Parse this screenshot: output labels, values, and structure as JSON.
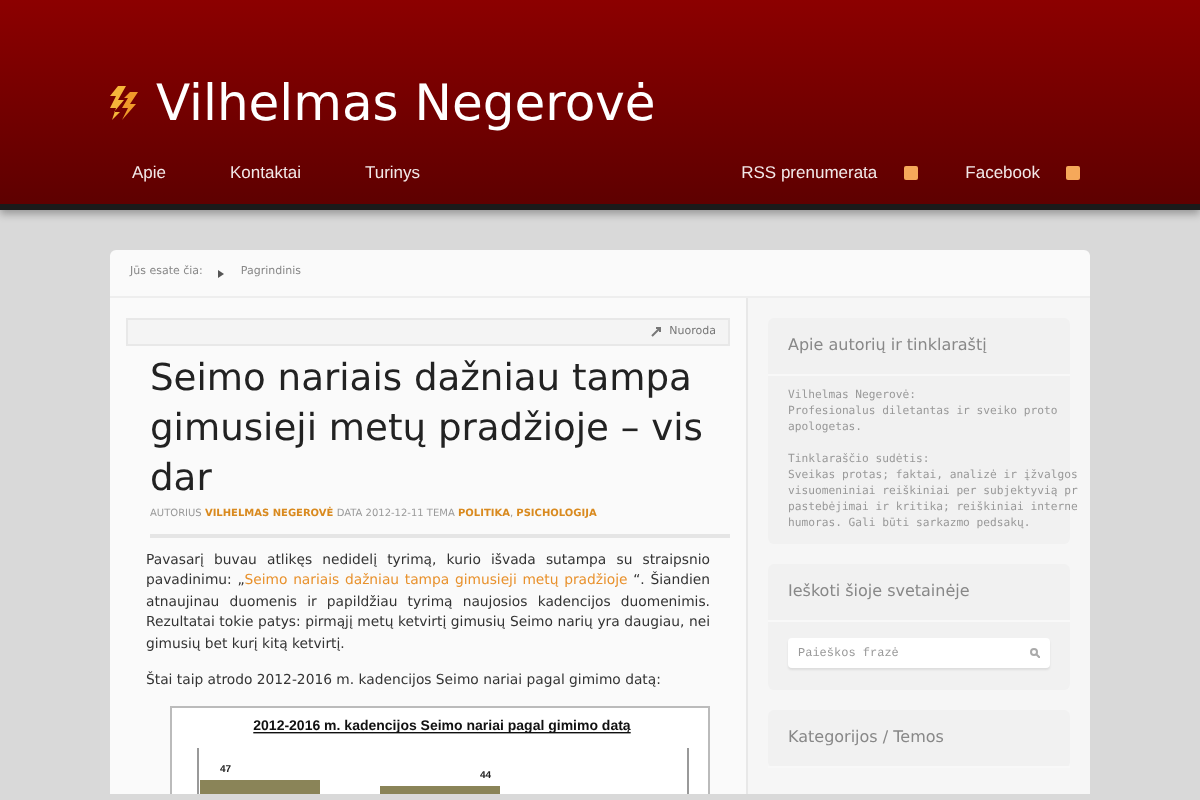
{
  "site_title": "Vilhelmas Negerovė",
  "nav_left": [
    "Apie",
    "Kontaktai",
    "Turinys"
  ],
  "nav_right": [
    "RSS prenumerata",
    "Facebook"
  ],
  "breadcrumb": {
    "label": "Jūs esate čia:",
    "items": [
      "Pagrindinis"
    ]
  },
  "post": {
    "toolbar_link": "Nuoroda",
    "title": "Seimo nariais dažniau tampa gimusieji metų pradžioje – vis dar",
    "meta": [
      {
        "kind": "plain",
        "text": "AUTORIUS"
      },
      {
        "kind": "link",
        "text": "VILHELMAS NEGEROVĖ"
      },
      {
        "kind": "plain",
        "text": "DATA 2012-12-11 TEMA"
      },
      {
        "kind": "link",
        "text": "POLITIKA"
      },
      {
        "kind": "plain",
        "text": ","
      },
      {
        "kind": "link",
        "text": "PSICHOLOGIJA"
      }
    ],
    "intro_before": "Pavasarį buvau atlikęs nedidelį tyrimą, kurio išvada sutampa su straipsnio pavadinimu:  „",
    "intro_link": "Seimo nariais dažniau tampa gimusieji metų pradžioje",
    "intro_after": "“. Šiandien atnaujinau duomenis ir papildžiau tyrimą naujosios kadencijos duomenimis. Rezultatai tokie patys: pirmąjį metų ketvirtį gimusių Seimo narių yra daugiau, nei gimusių bet kurį kitą ketvirtį.",
    "paragraph": "Štai taip atrodo 2012-2016 m. kadencijos Seimo nariai pagal gimimo datą:",
    "chart": {
      "title": "2012-2016 m. kadencijos Seimo nariai pagal gimimo datą",
      "bar_labels": [
        "47",
        "44"
      ]
    }
  },
  "sidebar": [
    {
      "kind": "text",
      "title": "Apie autorių ir tinklaraštį",
      "paragraphs": [
        [
          "Vilhelmas Negerovė:",
          "Profesionalus diletantas ir sveiko proto",
          "apologetas."
        ],
        [
          "Tinklaraščio sudėtis:",
          "Sveikas protas; faktai, analizė ir įžvalgos",
          "visuomeniniai reiškiniai per subjektyvią pr",
          "pastebėjimai ir kritika; reiškiniai interne",
          "humoras. Gali būti sarkazmo pedsakų."
        ]
      ]
    },
    {
      "kind": "search",
      "title": "Ieškoti šioje svetainėje",
      "placeholder": "Paieškos frazė"
    },
    {
      "kind": "text",
      "title": "Kategorijos / Temos"
    }
  ]
}
